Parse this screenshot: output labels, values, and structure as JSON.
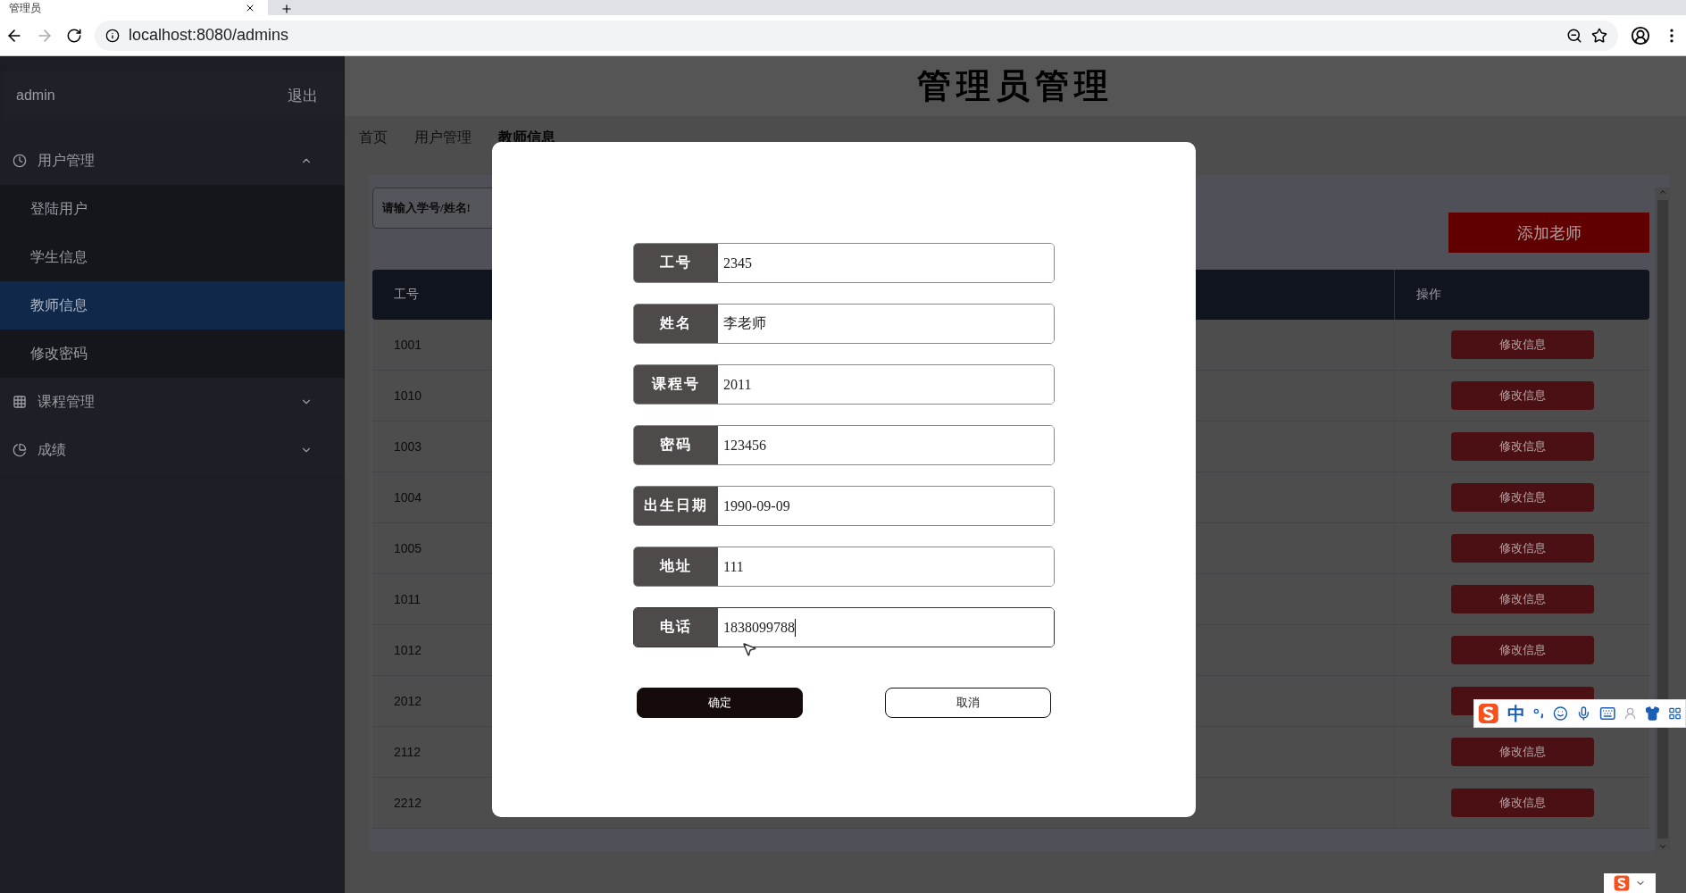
{
  "browser": {
    "tab_title": "管理员",
    "url": "localhost:8080/admins"
  },
  "sidebar": {
    "user": "admin",
    "logout": "退出",
    "menu": [
      {
        "label": "用户管理",
        "kind": "clock",
        "expanded": true,
        "children": [
          {
            "label": "登陆用户",
            "selected": false
          },
          {
            "label": "学生信息",
            "selected": false
          },
          {
            "label": "教师信息",
            "selected": true
          },
          {
            "label": "修改密码",
            "selected": false
          }
        ]
      },
      {
        "label": "课程管理",
        "kind": "grid",
        "expanded": false
      },
      {
        "label": "成绩",
        "kind": "chart",
        "expanded": false
      }
    ]
  },
  "header": {
    "title": "管理员管理"
  },
  "breadcrumb": [
    "首页",
    "用户管理",
    "教师信息"
  ],
  "search": {
    "placeholder": "请输入学号/姓名!"
  },
  "add_button": "添加老师",
  "table": {
    "columns": [
      "工号",
      "操作"
    ],
    "rows": [
      {
        "id": "1001",
        "action": "修改信息"
      },
      {
        "id": "1010",
        "action": "修改信息"
      },
      {
        "id": "1003",
        "action": "修改信息"
      },
      {
        "id": "1004",
        "action": "修改信息"
      },
      {
        "id": "1005",
        "action": "修改信息"
      },
      {
        "id": "1011",
        "action": "修改信息"
      },
      {
        "id": "1012",
        "action": "修改信息"
      },
      {
        "id": "2012"
      },
      {
        "id": "2112",
        "action": "修改信息"
      },
      {
        "id": "2212",
        "action": "修改信息"
      }
    ]
  },
  "dialog": {
    "fields": [
      {
        "label": "工号",
        "value": "2345",
        "focused": false
      },
      {
        "label": "姓名",
        "value": "李老师",
        "focused": false
      },
      {
        "label": "课程号",
        "value": "2011",
        "focused": false
      },
      {
        "label": "密码",
        "value": "123456",
        "focused": false
      },
      {
        "label": "出生日期",
        "value": "1990-09-09",
        "focused": false
      },
      {
        "label": "地址",
        "value": "111",
        "focused": false
      },
      {
        "label": "电话",
        "value": "1838099788",
        "focused": true
      }
    ],
    "buttons": [
      {
        "label": "确定",
        "kind": "primary"
      },
      {
        "label": "取消",
        "kind": "secondary"
      }
    ]
  },
  "ime_toolbar": {
    "mode": "中"
  }
}
